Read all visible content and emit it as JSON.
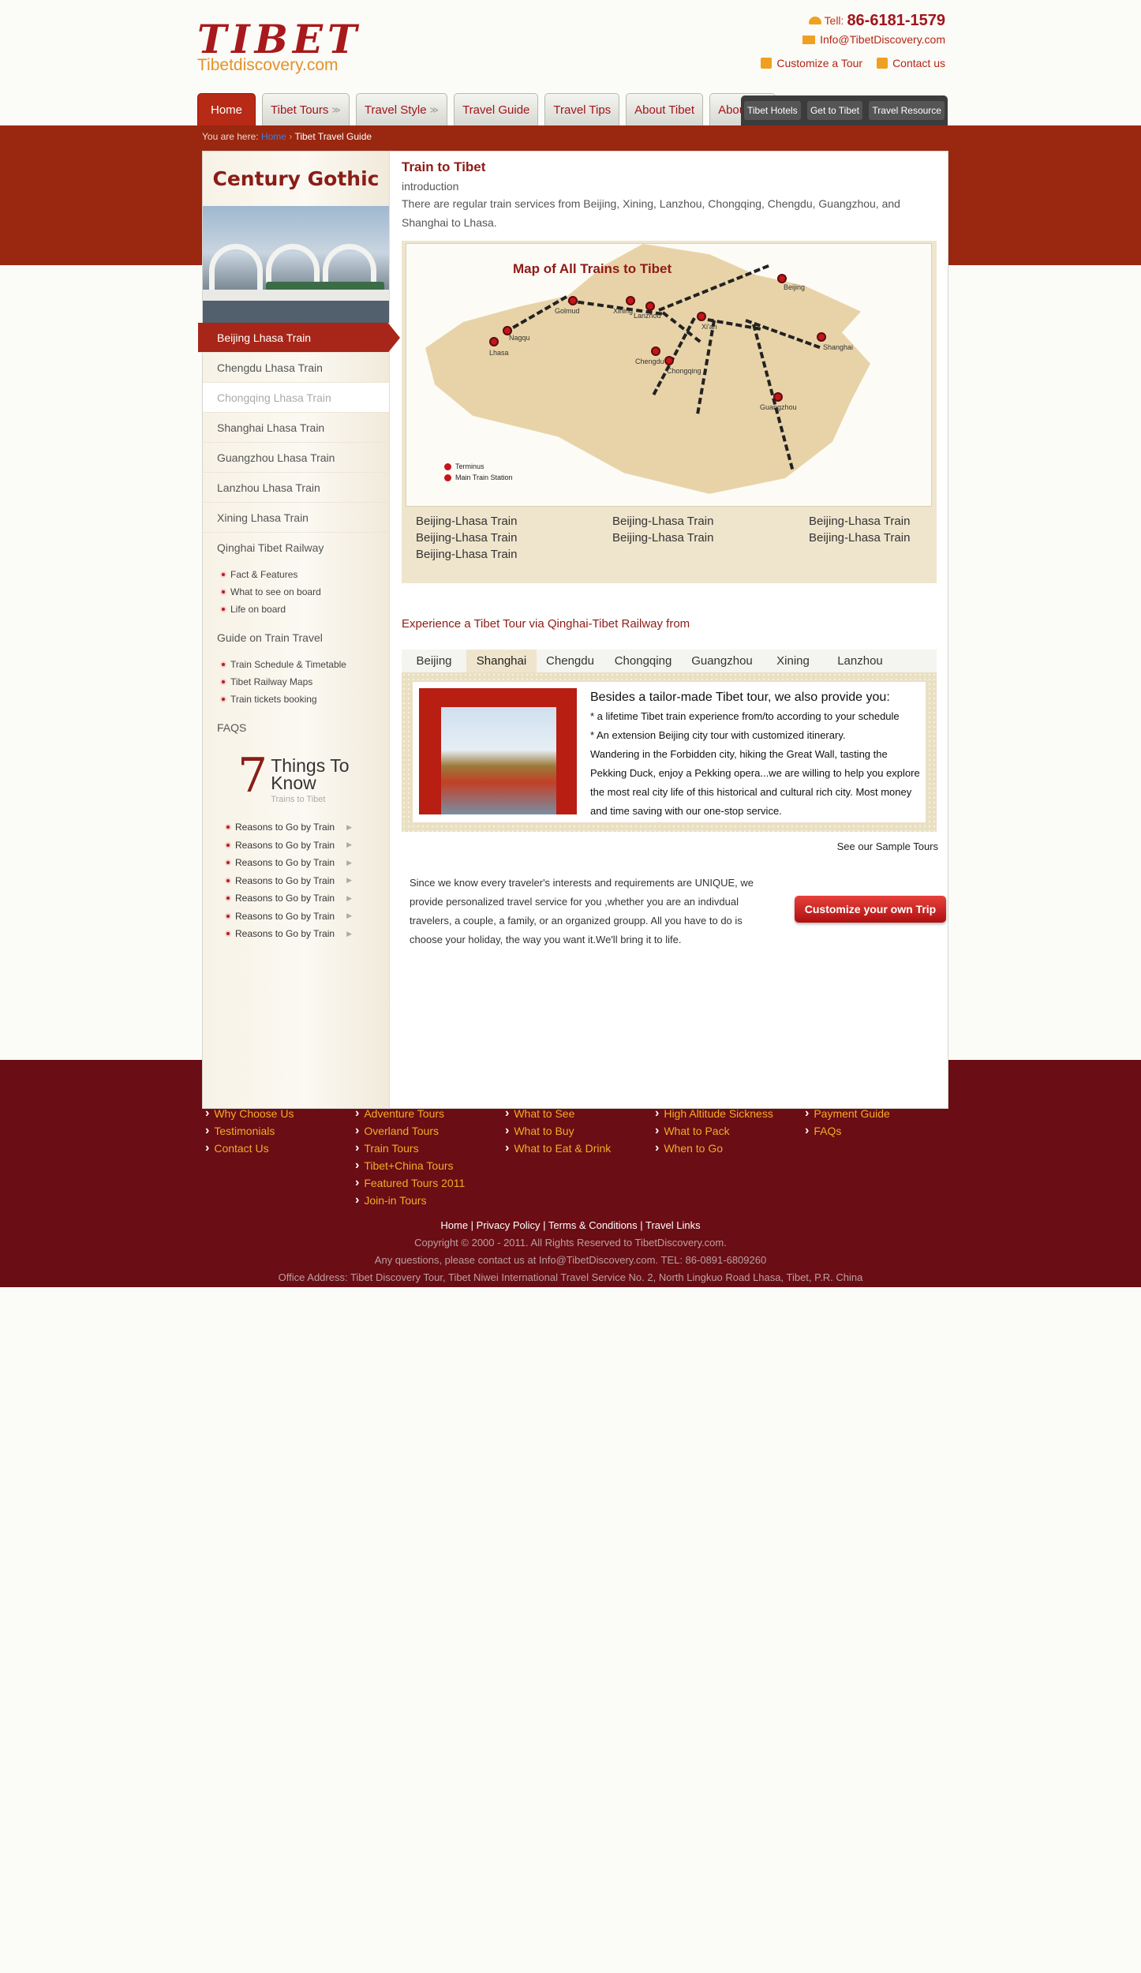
{
  "header": {
    "logo_main": "TIBET",
    "logo_sub": "Tibetdiscovery.com",
    "tell_label": "Tell:",
    "tell_number": "86-6181-1579",
    "email": "Info@TibetDiscovery.com",
    "customize_label": "Customize a Tour",
    "contact_label": "Contact us"
  },
  "nav": {
    "tabs": [
      "Home",
      "Tibet Tours",
      "Travel Style",
      "Travel Guide",
      "Travel Tips",
      "About Tibet",
      "About Us"
    ],
    "dark_tabs": [
      "Tibet Hotels",
      "Get to Tibet",
      "Travel Resource"
    ]
  },
  "breadcrumb": {
    "prefix": "You are here:",
    "home": "Home",
    "current": "Tibet Travel Guide"
  },
  "sidebar": {
    "title": "Century Gothic",
    "items": [
      "Beijing Lhasa Train",
      "Chengdu Lhasa Train",
      "Chongqing Lhasa Train",
      "Shanghai Lhasa Train",
      "Guangzhou Lhasa Train",
      "Lanzhou Lhasa Train",
      "Xining Lhasa Train",
      "Qinghai Tibet Railway"
    ],
    "qinghai_sub": [
      "Fact & Features",
      "What to see on board",
      "Life on board"
    ],
    "guide_title": "Guide on Train Travel",
    "guide_sub": [
      "Train Schedule & Timetable",
      "Tibet Railway Maps",
      "Train tickets booking"
    ],
    "faqs": "FAQS",
    "seven_num": "7",
    "seven_title": "Things To Know",
    "seven_sub": "Trains to Tibet",
    "reasons": [
      "Reasons to Go by Train",
      "Reasons to Go by Train",
      "Reasons to Go by Train",
      "Reasons to Go by Train",
      "Reasons to Go by Train",
      "Reasons to Go by Train",
      "Reasons to Go by Train"
    ]
  },
  "content": {
    "title": "Train to Tibet",
    "intro": "introduction",
    "desc": "There are regular train services from Beijing, Xining, Lanzhou, Chongqing, Chengdu, Guangzhou, and Shanghai to Lhasa.",
    "map_title": "Map of All Trains to Tibet",
    "map_cities": [
      "Beijing",
      "Golmud",
      "Xining",
      "Lanzhou",
      "Xi'an",
      "Nagqu",
      "Lhasa",
      "Chengdu",
      "Chongqing",
      "Shanghai",
      "Guangzhou"
    ],
    "legend_terminus": "Terminus",
    "legend_station": "Main Train Station",
    "train_links": [
      "Beijing-Lhasa Train",
      "Beijing-Lhasa Train",
      "Beijing-Lhasa Train",
      "Beijing-Lhasa Train",
      "Beijing-Lhasa Train",
      "Beijing-Lhasa Train",
      "Beijing-Lhasa Train"
    ],
    "exp_title": "Experience a Tibet Tour via Qinghai-Tibet Railway from",
    "city_tabs": [
      "Beijing",
      "Shanghai",
      "Chengdu",
      "Chongqing",
      "Guangzhou",
      "Xining",
      "Lanzhou"
    ],
    "active_city": "Shanghai",
    "promo_head": "Besides a tailor-made Tibet tour, we also provide you:",
    "promo_l1": "* a lifetime Tibet train experience from/to according to your schedule",
    "promo_l2": "* An extension Beijing city tour with customized itinerary.",
    "promo_l3": "Wandering in the Forbidden city, hiking the Great Wall, tasting the Pekking Duck, enjoy a Pekking opera...we are willing to help you explore the most real city life of this historical and cultural rich city. Most money and time saving with our one-stop service.",
    "see_tours": "See our Sample Tours",
    "service_text": "Since we know every traveler's interests and requirements are UNIQUE, we provide personalized travel service for you ,whether you are an indivdual travelers, a couple, a family, or an organized groupp. All you have to do is choose your holiday, the way you want it.We'll bring it to life.",
    "customize_btn": "Customize your own Trip"
  },
  "footer": {
    "col1": [
      "Why Choose Us",
      "Testimonials",
      "Contact Us"
    ],
    "col2": [
      "Adventure Tours",
      "Overland Tours",
      "Train Tours",
      "Tibet+China Tours",
      "Featured Tours 2011",
      "Join-in Tours"
    ],
    "col3": [
      "What to See",
      "What to Buy",
      "What to Eat & Drink"
    ],
    "col4": [
      "High Altitude Sickness",
      "What to Pack",
      "When to Go"
    ],
    "col5": [
      "Payment Guide",
      "FAQs"
    ],
    "links": "Home | Privacy Policy | Terms & Conditions | Travel Links",
    "copyright": "Copyright © 2000 - 2011. All Rights Reserved to TibetDiscovery.com.",
    "questions": "Any questions, please contact us at Info@TibetDiscovery.com. TEL: 86-0891-6809260",
    "address": "Office Address: Tibet Discovery Tour, Tibet Niwei International Travel Service No. 2, North Lingkuo Road Lhasa, Tibet, P.R. China"
  },
  "colors": {
    "brand_red": "#a1151b",
    "band_red": "#9a2710",
    "footer_bg": "#6a0d14",
    "footer_link": "#f3ab28"
  }
}
